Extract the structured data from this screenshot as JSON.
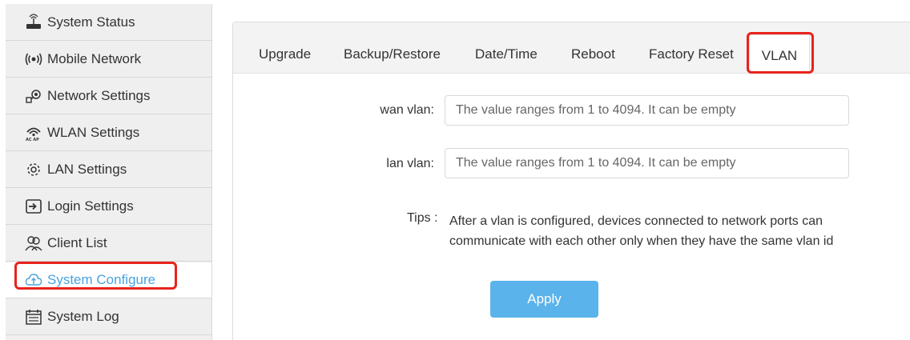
{
  "sidebar": {
    "items": [
      {
        "label": "System Status",
        "icon": "router-icon"
      },
      {
        "label": "Mobile Network",
        "icon": "signal-icon"
      },
      {
        "label": "Network Settings",
        "icon": "network-icon"
      },
      {
        "label": "WLAN Settings",
        "icon": "wifi-icon"
      },
      {
        "label": "LAN Settings",
        "icon": "gear-icon"
      },
      {
        "label": "Login Settings",
        "icon": "login-icon"
      },
      {
        "label": "Client List",
        "icon": "users-icon"
      },
      {
        "label": "System Configure",
        "icon": "cloud-upload-icon"
      },
      {
        "label": "System Log",
        "icon": "calendar-icon"
      }
    ],
    "active_color": "#4aa3df"
  },
  "tabs": [
    {
      "label": "Upgrade"
    },
    {
      "label": "Backup/Restore"
    },
    {
      "label": "Date/Time"
    },
    {
      "label": "Reboot"
    },
    {
      "label": "Factory Reset"
    },
    {
      "label": "VLAN"
    }
  ],
  "form": {
    "wan_label": "wan vlan:",
    "wan_placeholder": "The value ranges from 1 to 4094. It can be empty",
    "lan_label": "lan vlan:",
    "lan_placeholder": "The value ranges from 1 to 4094. It can be empty",
    "tips_label": "Tips :",
    "tips_text": "After a vlan is configured, devices connected to network ports can communicate with each other only when they have the same vlan id",
    "apply_label": "Apply"
  },
  "colors": {
    "highlight": "#e8231c",
    "apply_button": "#5ab3ea"
  }
}
